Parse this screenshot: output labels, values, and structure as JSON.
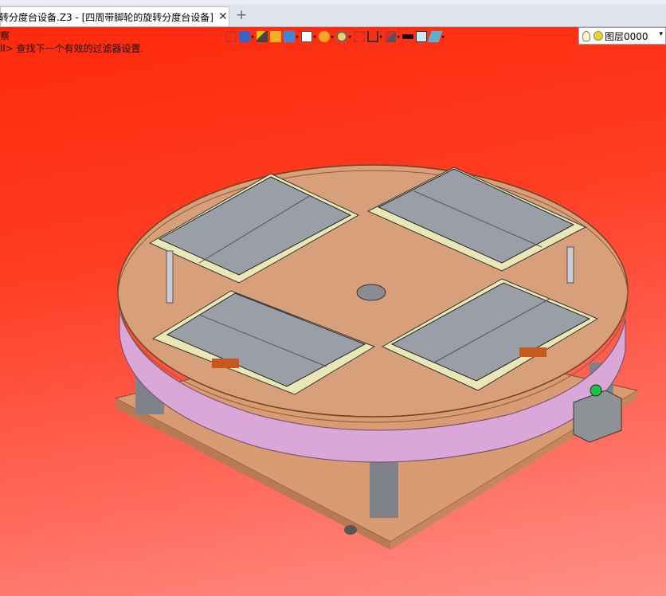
{
  "tab": {
    "title": "转分度台设备.Z3 - [四周带脚轮的旋转分度台设备]",
    "close_glyph": "✕",
    "new_tab_glyph": "+"
  },
  "command": {
    "label": "察",
    "prompt": "ll> 查找下一个有效的过滤器设置."
  },
  "toolbar": {
    "icons": [
      "exit-icon",
      "view-orient-icon",
      "sketch-icon",
      "shade-icon",
      "cube-view-icon",
      "box-view-icon",
      "pie-icon",
      "zoom-icon",
      "fit-icon",
      "section-icon",
      "filter-icon",
      "black-swatch",
      "white-swatch",
      "layer-color-icon"
    ]
  },
  "layer": {
    "name": "图层0000"
  },
  "colors": {
    "viewport_top": "#ff2a0c",
    "viewport_bottom": "#ff8f88",
    "table_top": "#d7a07a",
    "ring": "#d9a8d9",
    "fixture_plate": "#9a9ea6",
    "fixture_frame": "#e9e7b6"
  }
}
